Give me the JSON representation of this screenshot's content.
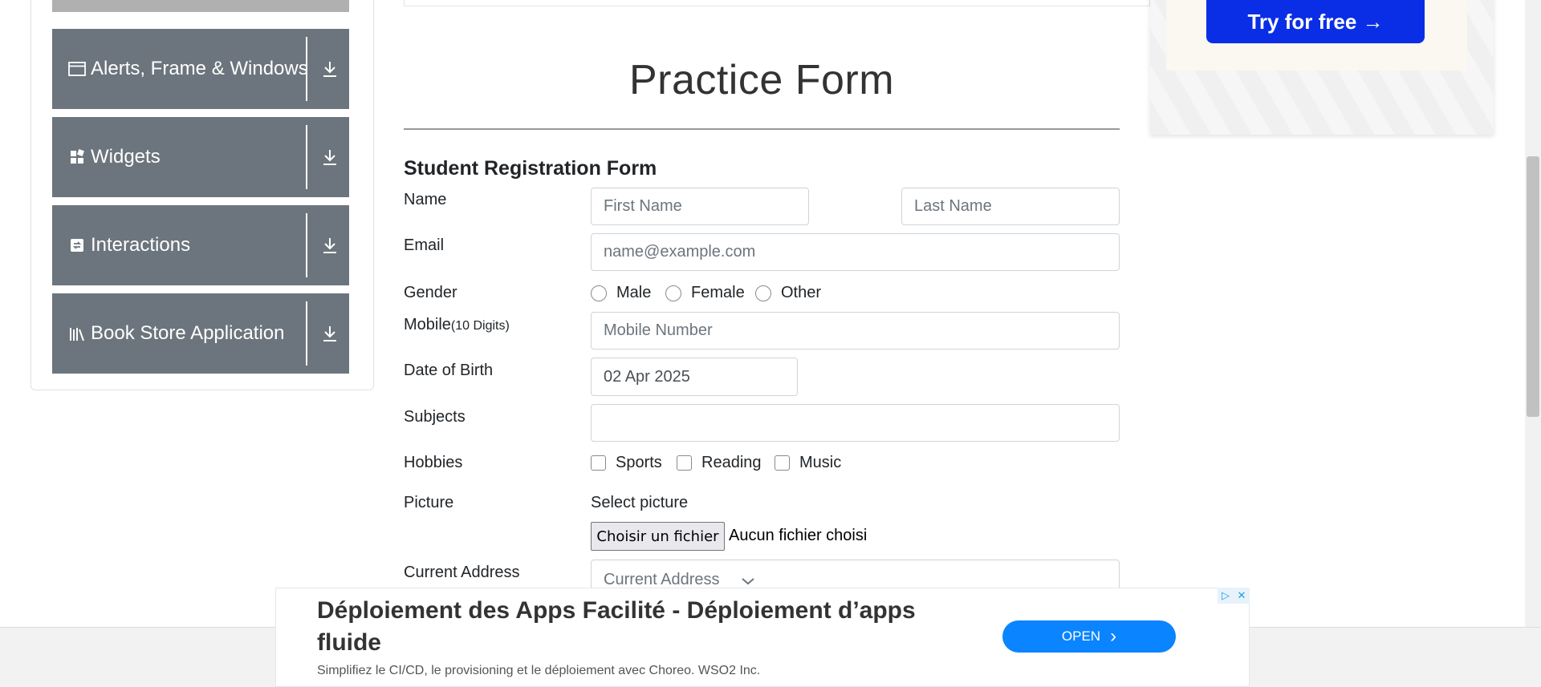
{
  "sidebar": {
    "groups": [
      {
        "label": "Alerts, Frame & Windows",
        "icon": "browser-window-icon"
      },
      {
        "label": "Widgets",
        "icon": "widgets-grid-icon"
      },
      {
        "label": "Interactions",
        "icon": "interactions-icon"
      },
      {
        "label": "Book Store Application",
        "icon": "books-icon"
      }
    ]
  },
  "form": {
    "title": "Practice Form",
    "subtitle": "Student Registration Form",
    "name_label": "Name",
    "first_name_placeholder": "First Name",
    "last_name_placeholder": "Last Name",
    "email_label": "Email",
    "email_placeholder": "name@example.com",
    "gender_label": "Gender",
    "gender_options": [
      "Male",
      "Female",
      "Other"
    ],
    "mobile_label": "Mobile",
    "mobile_hint": "(10 Digits)",
    "mobile_placeholder": "Mobile Number",
    "dob_label": "Date of Birth",
    "dob_value": "02 Apr 2025",
    "subjects_label": "Subjects",
    "hobbies_label": "Hobbies",
    "hobby_options": [
      "Sports",
      "Reading",
      "Music"
    ],
    "picture_label": "Picture",
    "select_picture": "Select picture",
    "file_button": "Choisir un fichier",
    "file_status": "Aucun fichier choisi",
    "address_label": "Current Address",
    "address_placeholder": "Current Address"
  },
  "ad_top": {
    "button": "Try for free →"
  },
  "ad_bottom": {
    "headline": "Déploiement des Apps Facilité - Déploiement d’apps fluide",
    "subline": "Simplifiez le CI/CD, le provisioning et le déploiement avec Choreo. WSO2 Inc.",
    "open_button": "OPEN",
    "open_chevron": "›",
    "badge_play": "▷",
    "badge_close": "✕"
  },
  "colors": {
    "sidebar_group": "#6c757d",
    "ad_button": "#0a2ee6",
    "open_button": "#0a84ff"
  }
}
